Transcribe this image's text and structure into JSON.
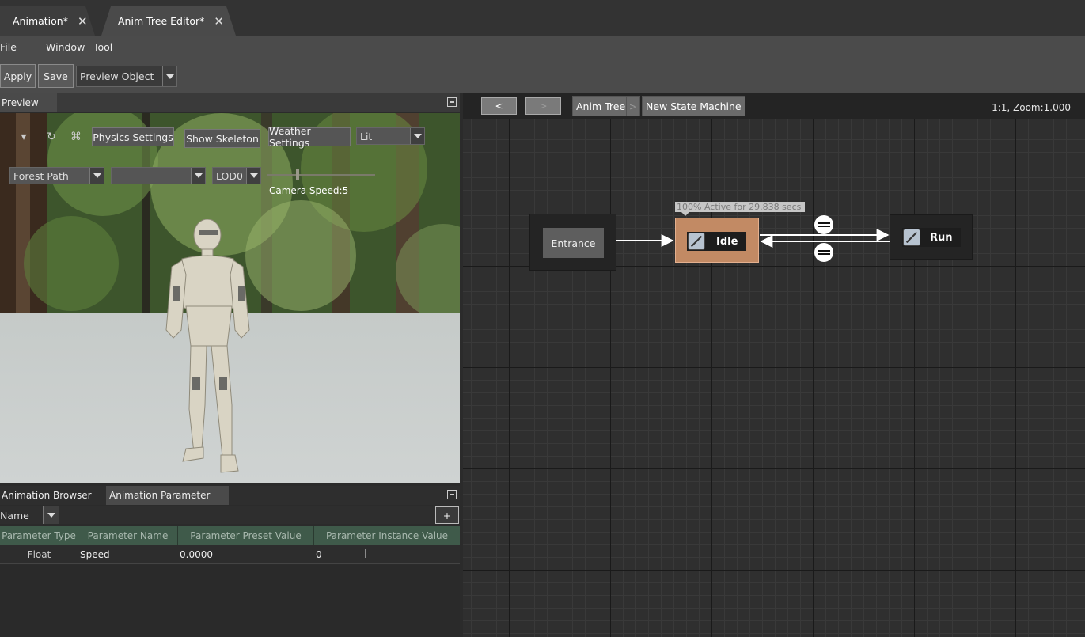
{
  "tabs": [
    {
      "label": "Animation*"
    },
    {
      "label": "Anim Tree Editor*"
    }
  ],
  "menu": [
    "File",
    "Window",
    "Tool"
  ],
  "toolbar": {
    "apply": "Apply",
    "save": "Save",
    "preview_object": "Preview Object"
  },
  "preview_panel": {
    "title": "Preview",
    "physics_settings": "Physics Settings",
    "show_skeleton": "Show Skeleton",
    "weather_settings": "Weather Settings",
    "lighting_mode": "Lit",
    "scene": "Forest Path",
    "animation_select": "",
    "lod": "LOD0",
    "camera_speed": "Camera Speed:5"
  },
  "bottom_panel": {
    "tabs": [
      "Animation Browser",
      "Animation Parameter"
    ],
    "filter": "Name",
    "add_button": "+",
    "columns": [
      "Parameter Type",
      "Parameter Name",
      "Parameter Preset Value",
      "Parameter Instance Value"
    ],
    "rows": [
      {
        "type": "Float",
        "name": "Speed",
        "preset": "0.0000",
        "instance": "0"
      }
    ]
  },
  "graph": {
    "back": "<",
    "forward": ">",
    "breadcrumbs": [
      "Anim Tree",
      ">",
      "New State Machine"
    ],
    "zoom": "1:1, Zoom:1.000",
    "entrance": "Entrance",
    "active_label": "100% Active for 29.838 secs",
    "states": [
      {
        "label": "Idle",
        "icon": "state-icon"
      },
      {
        "label": "Run",
        "icon": "state-icon"
      }
    ]
  },
  "colors": {
    "active_state": "#c28a64",
    "grid_bg": "#2f2f2f",
    "table_header": "#3f5a4a"
  }
}
